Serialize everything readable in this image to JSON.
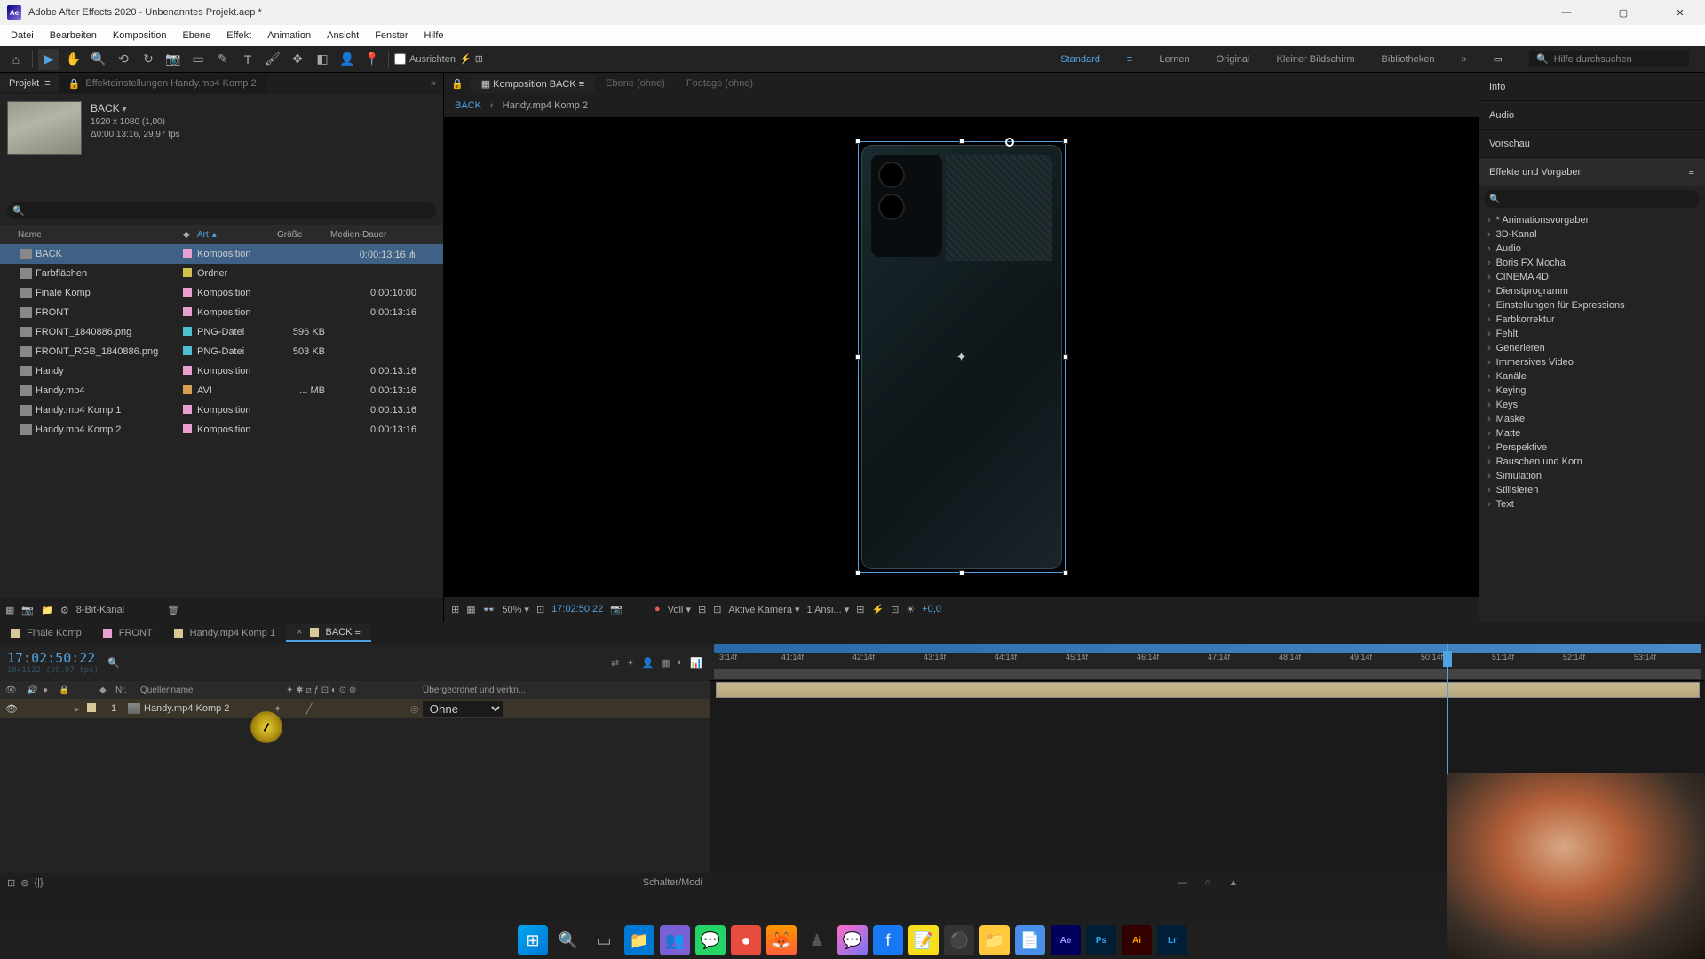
{
  "title": "Adobe After Effects 2020 - Unbenanntes Projekt.aep *",
  "menu": [
    "Datei",
    "Bearbeiten",
    "Komposition",
    "Ebene",
    "Effekt",
    "Animation",
    "Ansicht",
    "Fenster",
    "Hilfe"
  ],
  "tools": {
    "align": "Ausrichten"
  },
  "workspaces": [
    "Standard",
    "Lernen",
    "Original",
    "Kleiner Bildschirm",
    "Bibliotheken"
  ],
  "help_search": "Hilfe durchsuchen",
  "project_panel": {
    "tab_project": "Projekt",
    "tab_effect_controls": "Effekteinstellungen Handy.mp4 Komp 2",
    "comp_name": "BACK",
    "comp_res": "1920 x 1080 (1,00)",
    "comp_dur": "Δ0:00:13:16, 29,97 fps",
    "headers": {
      "name": "Name",
      "art": "Art",
      "size": "Größe",
      "dur": "Medien-Dauer"
    },
    "items": [
      {
        "name": "BACK",
        "art": "Komposition",
        "size": "",
        "dur": "0:00:13:16",
        "label": "#e8a0d0",
        "selected": true,
        "icon": "comp"
      },
      {
        "name": "Farbflächen",
        "art": "Ordner",
        "size": "",
        "dur": "",
        "label": "#d0c050",
        "icon": "folder"
      },
      {
        "name": "Finale Komp",
        "art": "Komposition",
        "size": "",
        "dur": "0:00:10:00",
        "label": "#e8a0d0",
        "icon": "comp"
      },
      {
        "name": "FRONT",
        "art": "Komposition",
        "size": "",
        "dur": "0:00:13:16",
        "label": "#e8a0d0",
        "icon": "comp"
      },
      {
        "name": "FRONT_1840886.png",
        "art": "PNG-Datei",
        "size": "596 KB",
        "dur": "",
        "label": "#50c0d0",
        "icon": "img"
      },
      {
        "name": "FRONT_RGB_1840886.png",
        "art": "PNG-Datei",
        "size": "503 KB",
        "dur": "",
        "label": "#50c0d0",
        "icon": "img"
      },
      {
        "name": "Handy",
        "art": "Komposition",
        "size": "",
        "dur": "0:00:13:16",
        "label": "#e8a0d0",
        "icon": "comp"
      },
      {
        "name": "Handy.mp4",
        "art": "AVI",
        "size": "... MB",
        "dur": "0:00:13:16",
        "label": "#d8a050",
        "icon": "mov"
      },
      {
        "name": "Handy.mp4 Komp 1",
        "art": "Komposition",
        "size": "",
        "dur": "0:00:13:16",
        "label": "#e8a0d0",
        "icon": "comp"
      },
      {
        "name": "Handy.mp4 Komp 2",
        "art": "Komposition",
        "size": "",
        "dur": "0:00:13:16",
        "label": "#e8a0d0",
        "icon": "comp"
      }
    ],
    "bpc": "8-Bit-Kanal"
  },
  "comp_panel": {
    "tabs": {
      "comp": "Komposition BACK",
      "layer": "Ebene (ohne)",
      "footage": "Footage (ohne)"
    },
    "crumb1": "BACK",
    "crumb2": "Handy.mp4 Komp 2",
    "zoom": "50%",
    "timecode": "17:02:50:22",
    "resolution": "Voll",
    "camera": "Aktive Kamera",
    "views": "1 Ansi...",
    "exposure": "+0,0"
  },
  "right_panels": {
    "info": "Info",
    "audio": "Audio",
    "preview": "Vorschau",
    "effects": "Effekte und Vorgaben",
    "categories": [
      "* Animationsvorgaben",
      "3D-Kanal",
      "Audio",
      "Boris FX Mocha",
      "CINEMA 4D",
      "Dienstprogramm",
      "Einstellungen für Expressions",
      "Farbkorrektur",
      "Fehlt",
      "Generieren",
      "Immersives Video",
      "Kanäle",
      "Keying",
      "Keys",
      "Maske",
      "Matte",
      "Perspektive",
      "Rauschen und Korn",
      "Simulation",
      "Stilisieren",
      "Text"
    ]
  },
  "timeline": {
    "tabs": [
      "Finale Komp",
      "FRONT",
      "Handy.mp4 Komp 1",
      "BACK"
    ],
    "active_tab": 3,
    "timecode": "17:02:50:22",
    "src_timecode": "1841122 (29,97 fps)",
    "cols": {
      "nr": "Nr.",
      "source": "Quellenname",
      "parent": "Übergeordnet und verkn..."
    },
    "layer": {
      "num": "1",
      "name": "Handy.mp4 Komp 2",
      "parent": "Ohne",
      "label": "#d8c898"
    },
    "ticks": [
      "3:14f",
      "41:14f",
      "42:14f",
      "43:14f",
      "44:14f",
      "45:14f",
      "46:14f",
      "47:14f",
      "48:14f",
      "49:14f",
      "50:14f",
      "51:14f",
      "52:14f",
      "53:14f"
    ],
    "bottom": "Schalter/Modi"
  }
}
